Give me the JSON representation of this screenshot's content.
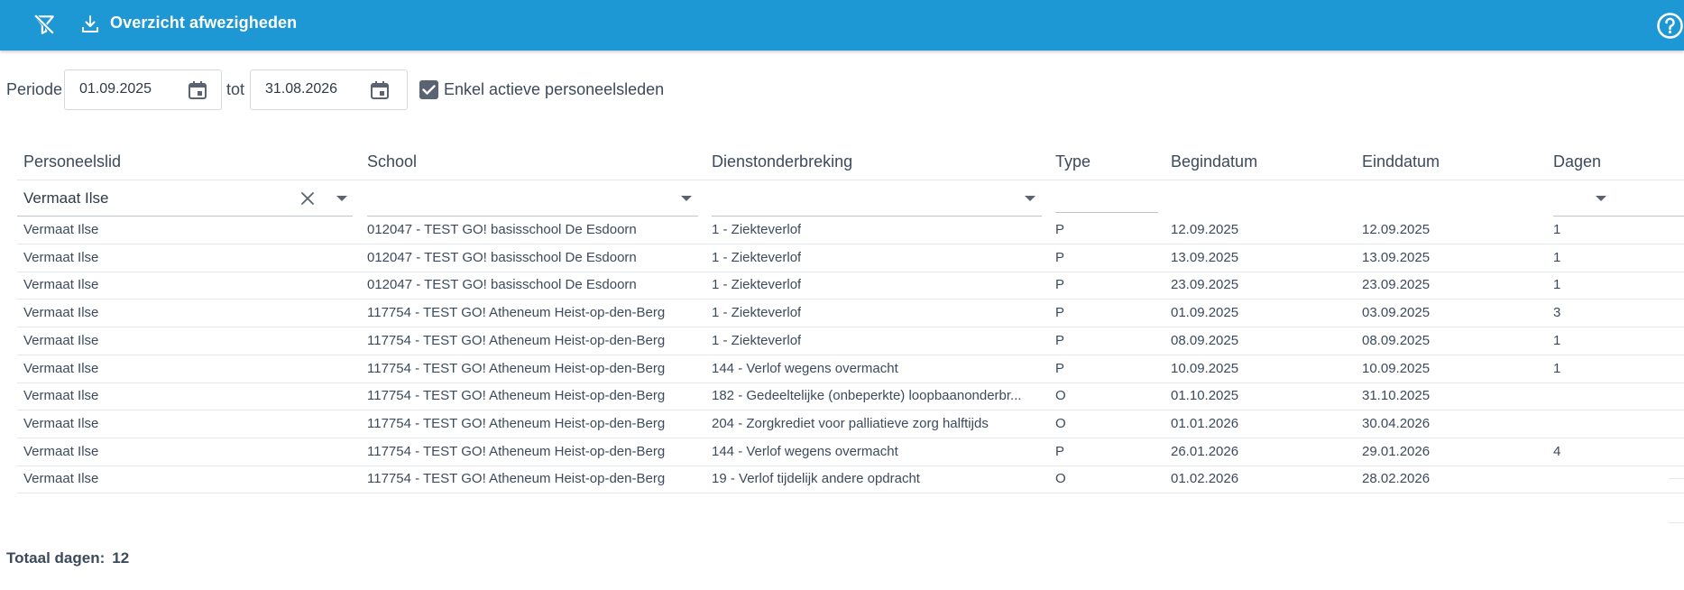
{
  "header": {
    "title": "Overzicht afwezigheden",
    "filter_off_icon": "filter-off-icon",
    "download_icon": "download-icon",
    "help_icon": "help-icon",
    "bar_color": "#1e98d4"
  },
  "filters": {
    "periode_label": "Periode",
    "date_from": "01.09.2025",
    "tot_label": "tot",
    "date_to": "31.08.2026",
    "only_active_label": "Enkel actieve personeelsleden",
    "only_active_checked": true
  },
  "table": {
    "columns": [
      "Personeelslid",
      "School",
      "Dienstonderbreking",
      "Type",
      "Begindatum",
      "Einddatum",
      "Dagen"
    ],
    "column_filters": {
      "personeelslid": "Vermaat Ilse",
      "school": "",
      "dienstonderbreking": "",
      "type": "",
      "dagen": ""
    },
    "rows": [
      [
        "Vermaat Ilse",
        "012047 - TEST GO! basisschool De Esdoorn",
        "1 - Ziekteverlof",
        "P",
        "12.09.2025",
        "12.09.2025",
        "1"
      ],
      [
        "Vermaat Ilse",
        "012047 - TEST GO! basisschool De Esdoorn",
        "1 - Ziekteverlof",
        "P",
        "13.09.2025",
        "13.09.2025",
        "1"
      ],
      [
        "Vermaat Ilse",
        "012047 - TEST GO! basisschool De Esdoorn",
        "1 - Ziekteverlof",
        "P",
        "23.09.2025",
        "23.09.2025",
        "1"
      ],
      [
        "Vermaat Ilse",
        "117754 - TEST GO! Atheneum Heist-op-den-Berg",
        "1 - Ziekteverlof",
        "P",
        "01.09.2025",
        "03.09.2025",
        "3"
      ],
      [
        "Vermaat Ilse",
        "117754 - TEST GO! Atheneum Heist-op-den-Berg",
        "1 - Ziekteverlof",
        "P",
        "08.09.2025",
        "08.09.2025",
        "1"
      ],
      [
        "Vermaat Ilse",
        "117754 - TEST GO! Atheneum Heist-op-den-Berg",
        "144 - Verlof wegens overmacht",
        "P",
        "10.09.2025",
        "10.09.2025",
        "1"
      ],
      [
        "Vermaat Ilse",
        "117754 - TEST GO! Atheneum Heist-op-den-Berg",
        "182 - Gedeeltelijke (onbeperkte) loopbaanonderbr...",
        "O",
        "01.10.2025",
        "31.10.2025",
        ""
      ],
      [
        "Vermaat Ilse",
        "117754 - TEST GO! Atheneum Heist-op-den-Berg",
        "204 - Zorgkrediet voor palliatieve zorg halftijds",
        "O",
        "01.01.2026",
        "30.04.2026",
        ""
      ],
      [
        "Vermaat Ilse",
        "117754 - TEST GO! Atheneum Heist-op-den-Berg",
        "144 - Verlof wegens overmacht",
        "P",
        "26.01.2026",
        "29.01.2026",
        "4"
      ],
      [
        "Vermaat Ilse",
        "117754 - TEST GO! Atheneum Heist-op-den-Berg",
        "19 - Verlof tijdelijk andere opdracht",
        "O",
        "01.02.2026",
        "28.02.2026",
        ""
      ]
    ]
  },
  "footer": {
    "total_label": "Totaal dagen:",
    "total_value": "12"
  }
}
